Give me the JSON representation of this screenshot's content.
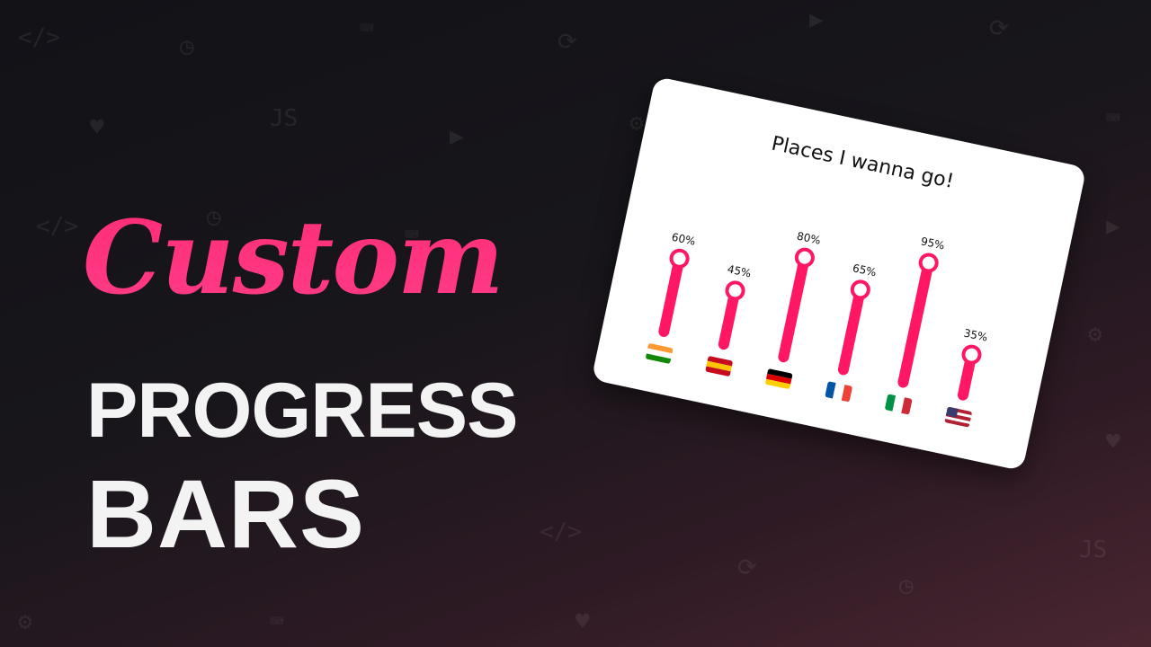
{
  "headline": {
    "script": "Custom",
    "line1": "PROGRESS",
    "line2": "BARS"
  },
  "card": {
    "title": "Places I wanna go!",
    "bars": [
      {
        "country": "India",
        "percent_label": "60%",
        "value": 60,
        "flag": "india-flag-icon"
      },
      {
        "country": "Spain",
        "percent_label": "45%",
        "value": 45,
        "flag": "spain-flag-icon"
      },
      {
        "country": "Germany",
        "percent_label": "80%",
        "value": 80,
        "flag": "germany-flag-icon"
      },
      {
        "country": "France",
        "percent_label": "65%",
        "value": 65,
        "flag": "france-flag-icon"
      },
      {
        "country": "Italy",
        "percent_label": "95%",
        "value": 95,
        "flag": "italy-flag-icon"
      },
      {
        "country": "USA",
        "percent_label": "35%",
        "value": 35,
        "flag": "usa-flag-icon"
      }
    ]
  },
  "colors": {
    "accent": "#ff1764",
    "script_text": "#ff2d7a",
    "headline_text": "#f3f3f3",
    "card_bg": "#ffffff"
  }
}
